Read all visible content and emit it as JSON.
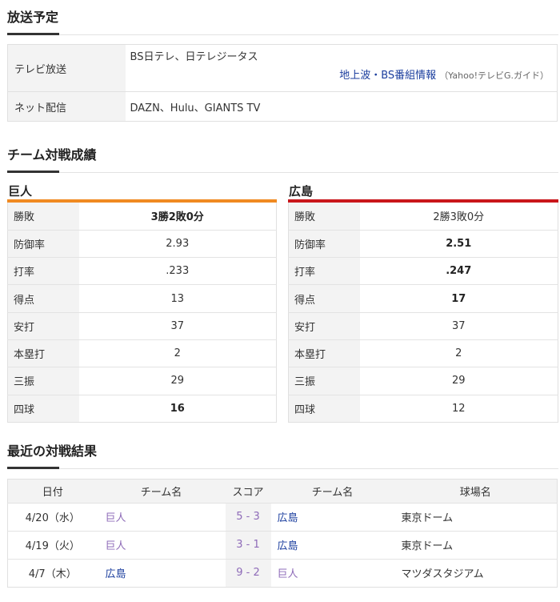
{
  "broadcast": {
    "title": "放送予定",
    "tv_label": "テレビ放送",
    "tv_value": "BS日テレ、日テレジータス",
    "guide_link": "地上波・BS番組情報",
    "guide_source": "（Yahoo!テレビG.ガイド）",
    "net_label": "ネット配信",
    "net_value": "DAZN、Hulu、GIANTS TV"
  },
  "stats": {
    "title": "チーム対戦成績",
    "teams": [
      {
        "name": "巨人",
        "color": "#f08a21",
        "rows": [
          {
            "label": "勝敗",
            "value": "3勝2敗0分",
            "bold": true
          },
          {
            "label": "防御率",
            "value": "2.93",
            "bold": false
          },
          {
            "label": "打率",
            "value": ".233",
            "bold": false
          },
          {
            "label": "得点",
            "value": "13",
            "bold": false
          },
          {
            "label": "安打",
            "value": "37",
            "bold": false
          },
          {
            "label": "本塁打",
            "value": "2",
            "bold": false
          },
          {
            "label": "三振",
            "value": "29",
            "bold": false
          },
          {
            "label": "四球",
            "value": "16",
            "bold": true
          }
        ]
      },
      {
        "name": "広島",
        "color": "#c9161b",
        "rows": [
          {
            "label": "勝敗",
            "value": "2勝3敗0分",
            "bold": false
          },
          {
            "label": "防御率",
            "value": "2.51",
            "bold": true
          },
          {
            "label": "打率",
            "value": ".247",
            "bold": true
          },
          {
            "label": "得点",
            "value": "17",
            "bold": true
          },
          {
            "label": "安打",
            "value": "37",
            "bold": false
          },
          {
            "label": "本塁打",
            "value": "2",
            "bold": false
          },
          {
            "label": "三振",
            "value": "29",
            "bold": false
          },
          {
            "label": "四球",
            "value": "12",
            "bold": false
          }
        ]
      }
    ]
  },
  "results": {
    "title": "最近の対戦結果",
    "headers": [
      "日付",
      "チーム名",
      "スコア",
      "チーム名",
      "球場名"
    ],
    "rows": [
      {
        "date": "4/20（水）",
        "team1": "巨人",
        "team1_win": false,
        "score": "5 - 3",
        "team2": "広島",
        "team2_win": true,
        "stadium": "東京ドーム"
      },
      {
        "date": "4/19（火）",
        "team1": "巨人",
        "team1_win": false,
        "score": "3 - 1",
        "team2": "広島",
        "team2_win": true,
        "stadium": "東京ドーム"
      },
      {
        "date": "4/7（木）",
        "team1": "広島",
        "team1_win": true,
        "score": "9 - 2",
        "team2": "巨人",
        "team2_win": false,
        "stadium": "マツダスタジアム"
      }
    ]
  }
}
